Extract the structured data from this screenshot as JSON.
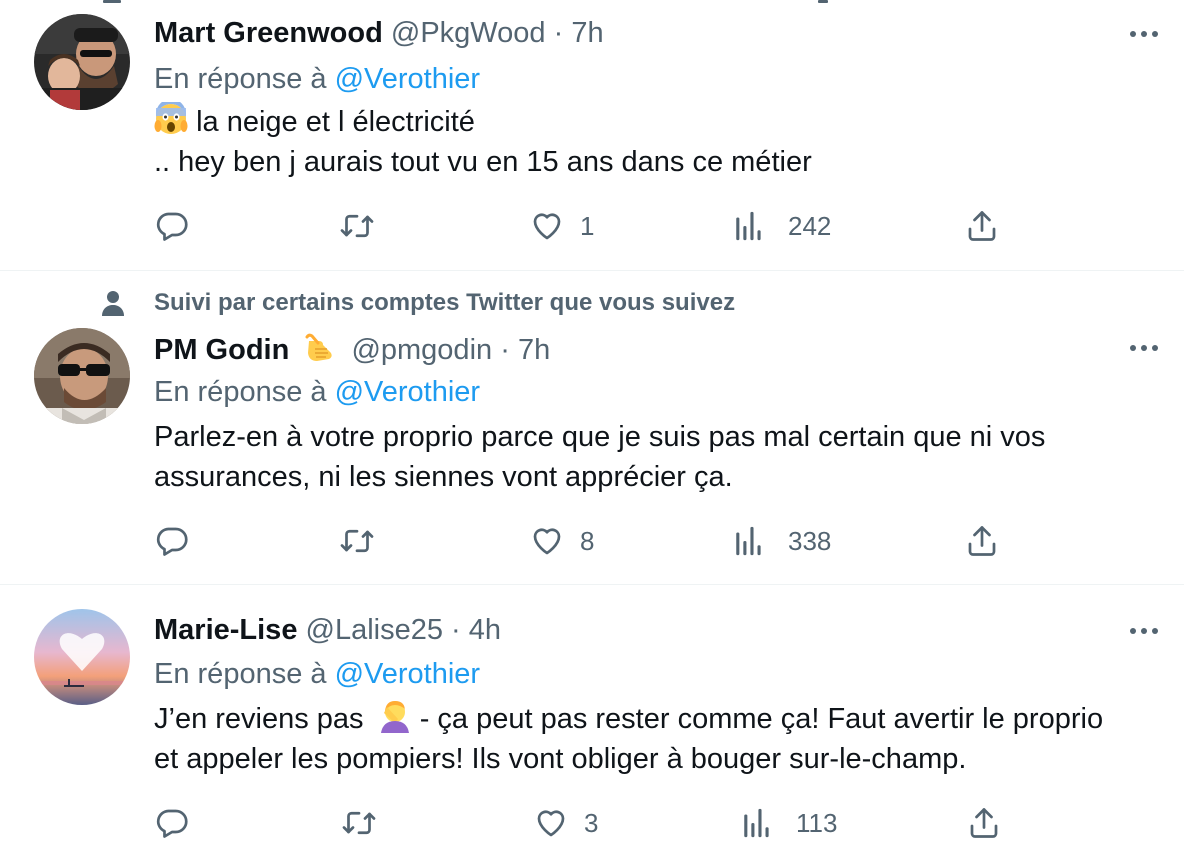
{
  "tweets": [
    {
      "name": "Mart Greenwood",
      "handle": "@PkgWood",
      "separator": "·",
      "time": "7h",
      "reply_prefix": "En réponse à",
      "reply_to": "@Verothier",
      "line1": "la neige et l électricité",
      "line2": ".. hey ben j aurais tout vu en 15 ans dans ce métier",
      "counts": {
        "like": "1",
        "views": "242"
      }
    },
    {
      "social_context": "Suivi par certains comptes Twitter que vous suivez",
      "name": "PM Godin",
      "handle": "@pmgodin",
      "separator": "·",
      "time": "7h",
      "reply_prefix": "En réponse à",
      "reply_to": "@Verothier",
      "line1": "Parlez-en à votre proprio parce que je suis pas mal certain que ni vos",
      "line2": "assurances, ni les siennes vont apprécier ça.",
      "counts": {
        "like": "8",
        "views": "338"
      }
    },
    {
      "name": "Marie-Lise",
      "handle": "@Lalise25",
      "separator": "·",
      "time": "4h",
      "reply_prefix": "En réponse à",
      "reply_to": "@Verothier",
      "line1a": "J’en reviens pas",
      "line1b": " - ça peut pas rester comme ça! Faut avertir le proprio",
      "line2": "et appeler les pompiers! Ils vont obliger à bouger sur-le-champ.",
      "counts": {
        "like": "3",
        "views": "113"
      }
    }
  ],
  "icons": {
    "reply": "reply-icon",
    "retweet": "retweet-icon",
    "like": "heart-icon",
    "views": "views-icon",
    "share": "share-icon",
    "more": "more-icon",
    "person": "person-icon"
  },
  "colors": {
    "text": "#0f1419",
    "secondary": "#536471",
    "link": "#1d9bf0",
    "divider": "#eff3f4"
  }
}
